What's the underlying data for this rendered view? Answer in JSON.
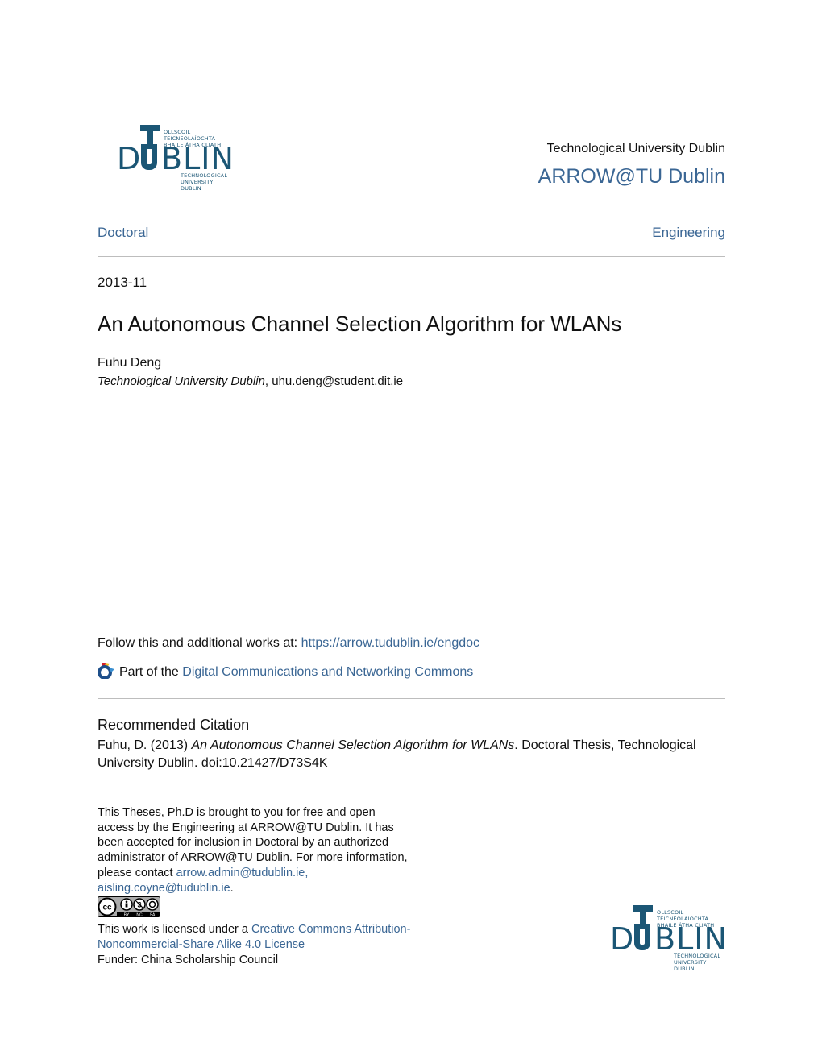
{
  "header": {
    "logo": {
      "letters_left": "D",
      "letter_t": "T",
      "letter_u": "U",
      "letters_right": "BLIN",
      "irish_line1": "OLLSCOIL TEICNEOLAÍOCHTA",
      "irish_line2": "BHAILE ÁTHA CLIATH",
      "english_line1": "TECHNOLOGICAL",
      "english_line2": "UNIVERSITY DUBLIN"
    },
    "institution": "Technological University Dublin",
    "repository": "ARROW@TU Dublin"
  },
  "breadcrumb": {
    "left": "Doctoral",
    "right": "Engineering"
  },
  "document": {
    "date": "2013-11",
    "title": "An Autonomous Channel Selection Algorithm for WLANs",
    "author": "Fuhu Deng",
    "affiliation": "Technological University Dublin",
    "affiliation_sep": ", ",
    "email": "uhu.deng@student.dit.ie"
  },
  "follow": {
    "prefix": "Follow this and additional works at: ",
    "url": "https://arrow.tudublin.ie/engdoc"
  },
  "part_of": {
    "icon": "bepress-commons-icon",
    "prefix": "Part of the ",
    "link": "Digital Communications and Networking Commons"
  },
  "citation": {
    "heading": "Recommended Citation",
    "prefix": "Fuhu, D. (2013) ",
    "title": "An Autonomous Channel Selection Algorithm for WLANs",
    "suffix": ". Doctoral Thesis, Technological University Dublin. doi:10.21427/D73S4K"
  },
  "access_statement": {
    "text": "This Theses, Ph.D is brought to you for free and open access by the Engineering at ARROW@TU Dublin. It has been accepted for inclusion in Doctoral by an authorized administrator of ARROW@TU Dublin. For more information, please contact ",
    "email1": "arrow.admin@tudublin.ie,",
    "email2": "aisling.coyne@tudublin.ie",
    "end": "."
  },
  "cc_badge": {
    "label_cc": "cc",
    "labels": [
      "BY",
      "NC",
      "SA"
    ]
  },
  "license": {
    "prefix": "This work is licensed under a ",
    "link": "Creative Commons Attribution-Noncommercial-Share Alike 4.0 License",
    "funder": "Funder: China Scholarship Council"
  },
  "colors": {
    "link": "#3a6694",
    "logo": "#1b5675",
    "rule": "#bdbdbd"
  }
}
